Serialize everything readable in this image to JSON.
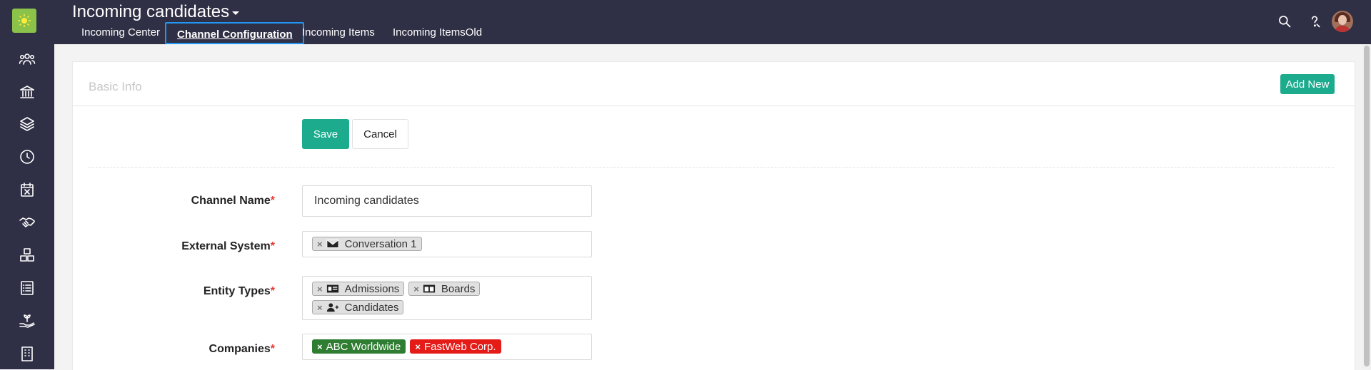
{
  "header": {
    "title": "Incoming candidates",
    "tabs": [
      {
        "label": "Incoming Center"
      },
      {
        "label": "Channel Configuration"
      },
      {
        "label": "Incoming Items"
      },
      {
        "label": "Incoming ItemsOld"
      }
    ]
  },
  "sidebar": {
    "icons": [
      "logo-icon",
      "users-icon",
      "bank-icon",
      "layers-icon",
      "clock-icon",
      "calendar-x-icon",
      "handshake-icon",
      "boxes-icon",
      "checklist-icon",
      "plant-hand-icon",
      "building-icon"
    ]
  },
  "card": {
    "title": "Basic Info",
    "add_new_label": "Add New",
    "save_label": "Save",
    "cancel_label": "Cancel"
  },
  "form": {
    "channel_name": {
      "label": "Channel Name",
      "value": "Incoming candidates"
    },
    "external_system": {
      "label": "External System",
      "chips": [
        "Conversation 1"
      ]
    },
    "entity_types": {
      "label": "Entity Types",
      "chips": [
        "Admissions",
        "Boards",
        "Candidates"
      ]
    },
    "companies": {
      "label": "Companies",
      "chips": [
        {
          "label": "ABC Worldwide",
          "color": "#2f7d32"
        },
        {
          "label": "FastWeb Corp.",
          "color": "#e41b17"
        }
      ]
    },
    "required_marker": "*"
  }
}
